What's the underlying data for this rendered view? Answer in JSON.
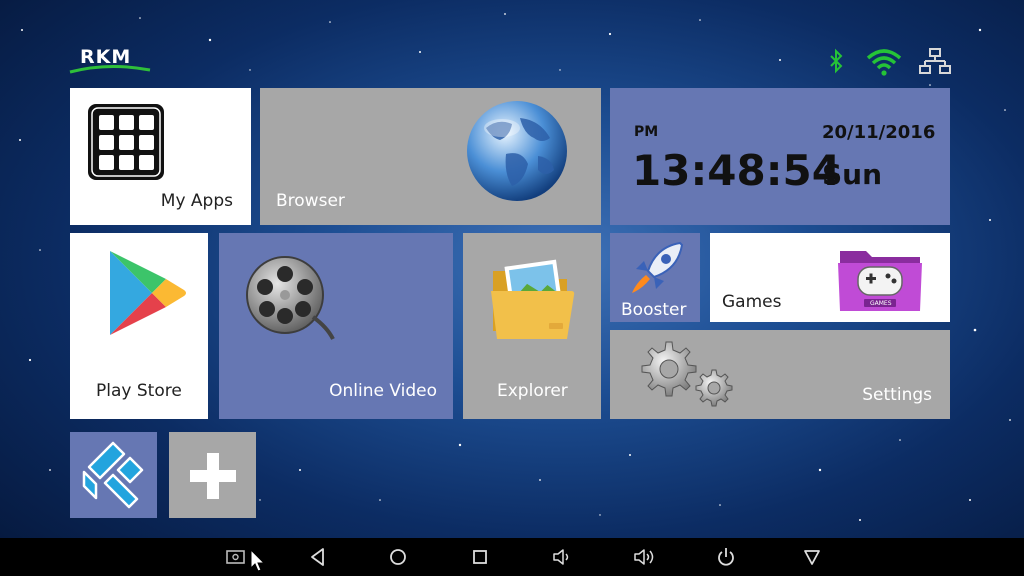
{
  "brand": {
    "logo_text": "RKM"
  },
  "status_bar": {
    "icons": [
      "bluetooth-icon",
      "wifi-icon",
      "ethernet-icon"
    ],
    "colors": {
      "bluetooth": "#25c337",
      "wifi": "#25c337",
      "ethernet": "#d8d8d8"
    }
  },
  "tiles": {
    "my_apps": "My Apps",
    "browser": "Browser",
    "play_store": "Play Store",
    "online_video": "Online Video",
    "explorer": "Explorer",
    "booster": "Booster",
    "games": "Games",
    "games_badge": "GAMES",
    "settings": "Settings"
  },
  "clock": {
    "ampm": "PM",
    "time": "13:48:54",
    "date": "20/11/2016",
    "day": "Sun"
  },
  "colors": {
    "tile_blue": "#6677b3",
    "tile_gray": "#a7a7a7",
    "tile_white": "#ffffff"
  },
  "navbar": {
    "buttons": [
      "screenshot-icon",
      "back-icon",
      "home-icon",
      "recents-icon",
      "volume-down-icon",
      "volume-up-icon",
      "power-icon",
      "menu-down-icon"
    ]
  }
}
